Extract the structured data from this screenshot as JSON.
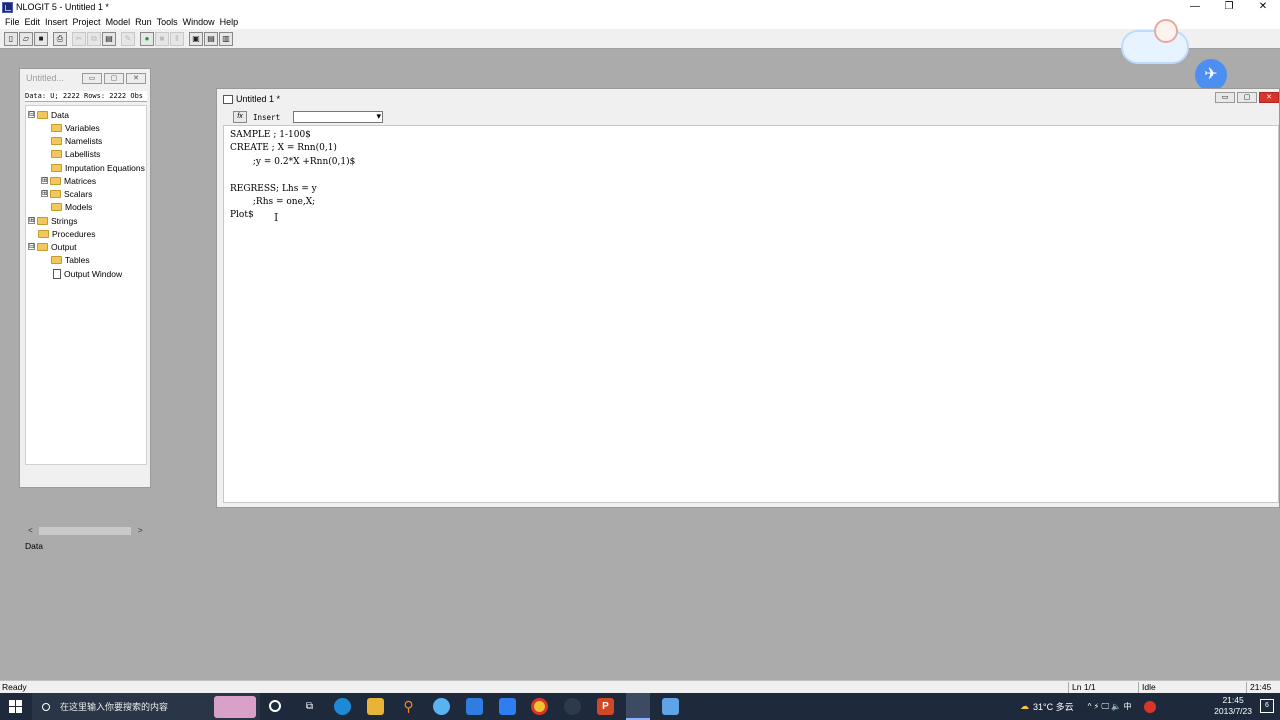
{
  "app": {
    "title": "NLOGIT 5 - Untitled 1 *",
    "controls": {
      "minimize": "—",
      "restore": "❐",
      "close": "✕"
    }
  },
  "menu": [
    "File",
    "Edit",
    "Insert",
    "Project",
    "Model",
    "Run",
    "Tools",
    "Window",
    "Help"
  ],
  "toolbar": {
    "buttons": [
      {
        "name": "new-icon",
        "glyph": "▯"
      },
      {
        "name": "open-icon",
        "glyph": "▱"
      },
      {
        "name": "save-icon",
        "glyph": "■"
      },
      {
        "name": "print-icon",
        "glyph": "⎙"
      },
      {
        "name": "cut-icon",
        "glyph": "✂"
      },
      {
        "name": "copy-icon",
        "glyph": "⧉"
      },
      {
        "name": "paste-icon",
        "glyph": "▤"
      },
      {
        "name": "edit-icon",
        "glyph": "✎"
      },
      {
        "name": "run-icon",
        "glyph": "●"
      },
      {
        "name": "stop-icon",
        "glyph": "■"
      },
      {
        "name": "pause-icon",
        "glyph": "Ⅱ"
      },
      {
        "name": "window-icon-1",
        "glyph": "▣"
      },
      {
        "name": "window-icon-2",
        "glyph": "▤"
      },
      {
        "name": "window-icon-3",
        "glyph": "▥"
      }
    ]
  },
  "project": {
    "title": "Untitled...",
    "controls": {
      "minimize": "▭",
      "maximize": "▢",
      "close": "✕"
    },
    "info": "Data: U; 2222 Rows: 2222 Obs",
    "tree": [
      {
        "label": "Data",
        "expander": "⊟",
        "type": "folder"
      },
      {
        "label": "Variables",
        "type": "folder"
      },
      {
        "label": "Namelists",
        "type": "folder"
      },
      {
        "label": "Labellists",
        "type": "folder"
      },
      {
        "label": "Imputation Equations",
        "type": "folder"
      },
      {
        "label": "Matrices",
        "expander": "⊞",
        "type": "folder"
      },
      {
        "label": "Scalars",
        "expander": "⊞",
        "type": "folder"
      },
      {
        "label": "Models",
        "type": "folder"
      },
      {
        "label": "Strings",
        "expander": "⊞",
        "type": "folder"
      },
      {
        "label": "Procedures",
        "type": "folder"
      },
      {
        "label": "Output",
        "expander": "⊟",
        "type": "folder"
      },
      {
        "label": "Tables",
        "type": "folder"
      },
      {
        "label": "Output Window",
        "type": "document"
      }
    ],
    "scroll_left": "<",
    "scroll_right": ">",
    "status": "Data"
  },
  "editor": {
    "title": "Untitled 1 *",
    "controls": {
      "minimize": "▭",
      "maximize": "▢",
      "close": "✕"
    },
    "fx_label": "fx",
    "insert_label": "Insert",
    "insert_value": "",
    "lines": [
      "SAMPLE ; 1-100$",
      "CREATE ; X = Rnn(0,1)",
      "        ;y = 0.2*X +Rnn(0,1)$",
      "",
      "REGRESS; Lhs = y",
      "        ;Rhs = one,X;",
      "Plot$"
    ],
    "cursor": "I"
  },
  "status": {
    "left": "Ready",
    "line": "Ln 1/1",
    "state": "Idle",
    "time": "21:45"
  },
  "taskbar": {
    "search_placeholder": "在这里输入你要搜索的内容",
    "weather": "31°C 多云",
    "tray_symbols": "^ ⚡ 🖵 🔈 中",
    "clock_time": "21:45",
    "clock_date": "2013/7/23",
    "notif_count": "6"
  }
}
